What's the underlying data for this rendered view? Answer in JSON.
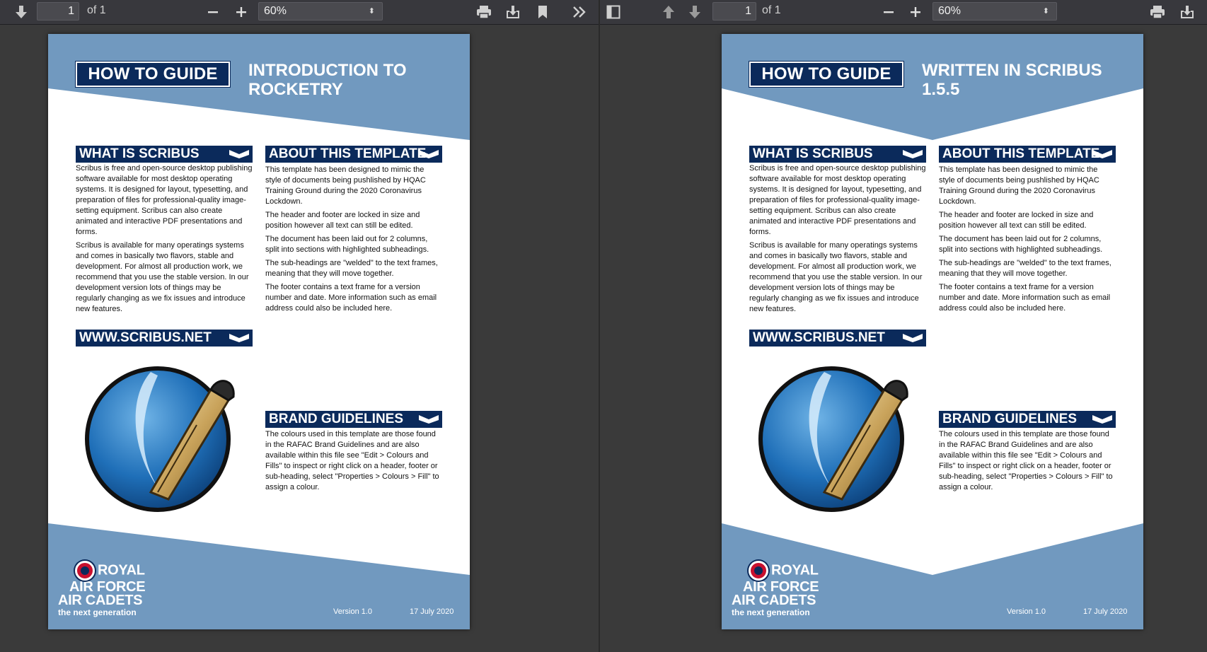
{
  "left_pane": {
    "toolbar": {
      "page_number": "1",
      "page_of": "of 1",
      "zoom": "60%"
    },
    "document": {
      "header_label": "HOW TO GUIDE",
      "header_title": "INTRODUCTION TO ROCKETRY",
      "sections": {
        "what_is": {
          "heading": "WHAT IS SCRIBUS",
          "paragraphs": [
            "Scribus is free and open-source desktop publishing software available for most desktop operating systems. It is designed for layout, typesetting, and preparation of files for professional-quality image-setting equipment. Scribus can also create animated and interactive PDF presentations and forms.",
            "Scribus is available for many operatings systems and comes in basically two flavors, stable and development. For almost all production work, we recommend that you use the stable version. In our development version lots of things may be regularly changing as we fix issues and introduce new features."
          ]
        },
        "about": {
          "heading": "ABOUT THIS TEMPLATE",
          "paragraphs": [
            "This template has been designed to mimic the style of documents being pushlished by HQAC Training Ground during the 2020 Coronavirus Lockdown.",
            "The header and footer are locked in size and position however all text can still be edited.",
            "The document has been laid out for 2 columns, split into sections with highlighted subheadings.",
            "The sub-headings are \"welded\" to the text frames, meaning that they will move together.",
            "The footer contains a text frame for a version number and date. More information such as email address could also be included here."
          ]
        },
        "website": {
          "heading": "WWW.SCRIBUS.NET"
        },
        "brand": {
          "heading": "BRAND GUIDELINES",
          "paragraphs": [
            "The colours used in this template are those found in the RAFAC Brand Guidelines and are also available within this file see \"Edit > Colours and Fills\" to inspect or right click on a header, footer or sub-heading, select \"Properties > Colours > Fill\" to assign a colour."
          ]
        }
      },
      "footer": {
        "logo_line1": "ROYAL",
        "logo_line2": "AIR FORCE",
        "logo_line3": "AIR CADETS",
        "logo_tagline": "the next generation",
        "version": "Version 1.0",
        "date": "17 July 2020"
      }
    }
  },
  "right_pane": {
    "toolbar": {
      "page_number": "1",
      "page_of": "of 1",
      "zoom": "60%"
    },
    "document": {
      "header_label": "HOW TO GUIDE",
      "header_title": "WRITTEN IN SCRIBUS 1.5.5",
      "sections": {
        "what_is": {
          "heading": "WHAT IS SCRIBUS",
          "paragraphs": [
            "Scribus is free and open-source desktop publishing software available for most desktop operating systems. It is designed for layout, typesetting, and preparation of files for professional-quality image-setting equipment. Scribus can also create animated and interactive PDF presentations and forms.",
            "Scribus is available for many operatings systems and comes in basically two flavors, stable and development. For almost all production work, we recommend that you use the stable version. In our development version lots of things may be regularly changing as we fix issues and introduce new features."
          ]
        },
        "about": {
          "heading": "ABOUT THIS TEMPLATE",
          "paragraphs": [
            "This template has been designed to mimic the style of documents being pushlished by HQAC Training Ground during the 2020 Coronavirus Lockdown.",
            "The header and footer are locked in size and position however all text can still be edited.",
            "The document has been laid out for 2 columns, split into sections with highlighted subheadings.",
            "The sub-headings are \"welded\" to the text frames, meaning that they will move together.",
            "The footer contains a text frame for a version number and date. More information such as email address could also be included here."
          ]
        },
        "website": {
          "heading": "WWW.SCRIBUS.NET"
        },
        "brand": {
          "heading": "BRAND GUIDELINES",
          "paragraphs": [
            "The colours used in this template are those found in the RAFAC Brand Guidelines and are also available within this file see \"Edit > Colours and Fills\" to inspect or right click on a header, footer or sub-heading, select \"Properties > Colours > Fill\" to assign a colour."
          ]
        }
      },
      "footer": {
        "logo_line1": "ROYAL",
        "logo_line2": "AIR FORCE",
        "logo_line3": "AIR CADETS",
        "logo_tagline": "the next generation",
        "version": "Version 1.0",
        "date": "17 July 2020"
      }
    }
  },
  "colors": {
    "navy": "#0b2a5b",
    "steel_blue": "#7199bf",
    "roundel_red": "#c8102e"
  },
  "icons": [
    "arrow-down-icon",
    "arrow-up-icon",
    "minus-icon",
    "plus-icon",
    "print-icon",
    "download-icon",
    "bookmark-icon",
    "double-chevron-right-icon",
    "sidebar-toggle-icon",
    "chevron-down-icon",
    "scribus-logo",
    "raf-roundel-icon"
  ]
}
